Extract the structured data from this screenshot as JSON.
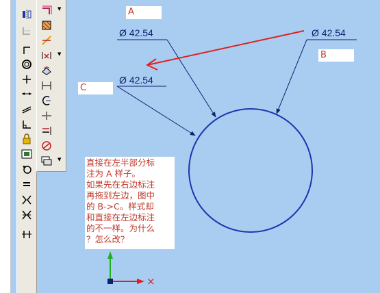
{
  "labels": {
    "a": "A",
    "b": "B",
    "c": "C"
  },
  "dimensions": {
    "top": "Ø 42.54",
    "right": "Ø 42.54",
    "left": "Ø 42.54"
  },
  "note": {
    "lines": [
      "直接在左半部分标",
      "注为 A 样子。",
      "如果先在右边标注",
      "再拖到左边，图中",
      "的 B->C。样式却",
      "和直接在左边标注",
      "的不一样。为什么",
      "？怎么改？"
    ]
  },
  "axis": {
    "x_label": "×"
  },
  "toolbar_left": {
    "icons": [
      "mirror-icon",
      "guide-icon",
      "line-icon",
      "circle-icon",
      "point-icon",
      "dimension-icon",
      "parallel-icon",
      "corner-icon",
      "lock-icon",
      "grid-icon",
      "rotate-icon",
      "equal-icon",
      "symmetric-icon",
      "pattern-icon",
      "split-icon"
    ]
  },
  "toolbar_right": {
    "icons": [
      "offset-icon",
      "fill-icon",
      "trim-icon",
      "extend-icon",
      "transform-icon",
      "dimension-h-icon",
      "arc-dim-icon",
      "break-icon",
      "align-icon",
      "no-icon",
      "layers-icon"
    ]
  },
  "colors": {
    "background": "#a9cdf0",
    "geometry": "#1a35b0",
    "leader": "#102070",
    "arrow": "#e02020",
    "label_text": "#c0392b",
    "axis_y": "#20b020",
    "axis_x": "#e02020"
  }
}
